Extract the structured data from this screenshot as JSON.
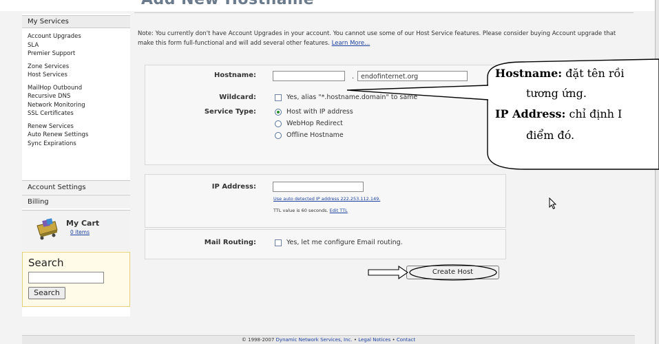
{
  "page": {
    "heading": "Add New Hostname",
    "note_text": "Note: You currently don't have Account Upgrades in your account. You cannot use some of our Host Service features. Please consider buying Account upgrade that make this form full-functional and will add several other features.",
    "note_link": "Learn More..."
  },
  "sidebar": {
    "section_title": "My Services",
    "items": [
      "Account Upgrades",
      "SLA",
      "Premier Support",
      "Zone Services",
      "Host Services",
      "MailHop Outbound",
      "Recursive DNS",
      "Network Monitoring",
      "SSL Certificates",
      "Renew Services",
      "Auto Renew Settings",
      "Sync Expirations"
    ],
    "account_settings": "Account Settings",
    "billing": "Billing",
    "cart_title": "My Cart",
    "cart_items": "0 items",
    "search_title": "Search",
    "search_value": "",
    "search_button": "Search"
  },
  "form": {
    "hostname_label": "Hostname:",
    "hostname_value": "",
    "domain_separator": ".",
    "domain_value": "endofinternet.org",
    "wildcard_label": "Wildcard:",
    "wildcard_option": "Yes, alias \"*.hostname.domain\" to same",
    "service_type_label": "Service Type:",
    "service_options": [
      "Host with IP address",
      "WebHop Redirect",
      "Offline Hostname"
    ],
    "service_selected": "Host with IP address",
    "ip_label": "IP Address:",
    "ip_value": "",
    "ip_detect_link": "Use auto detected IP address 222.253.112.149.",
    "ttl_text": "TTL value is 60 seconds.",
    "ttl_link": "Edit TTL",
    "mail_label": "Mail Routing:",
    "mail_option": "Yes, let me configure Email routing.",
    "create_button": "Create Host"
  },
  "footer": {
    "copyright": "© 1998-2007",
    "company_link": "Dynamic Network Services, Inc.",
    "sep": "•",
    "legal_link": "Legal Notices",
    "contact_link": "Contact"
  },
  "annotation": {
    "hostname_term": "Hostname:",
    "hostname_desc_1": "đặt tên rồi",
    "hostname_desc_2": "tương ứng.",
    "ip_term": "IP Address:",
    "ip_desc_1": "chỉ định I",
    "ip_desc_2": "điểm đó."
  },
  "colors": {
    "link": "#1a3fa0",
    "panel_bg": "#f7f7f7",
    "search_bg": "#fffbe8",
    "heading": "#6b7b8c"
  }
}
